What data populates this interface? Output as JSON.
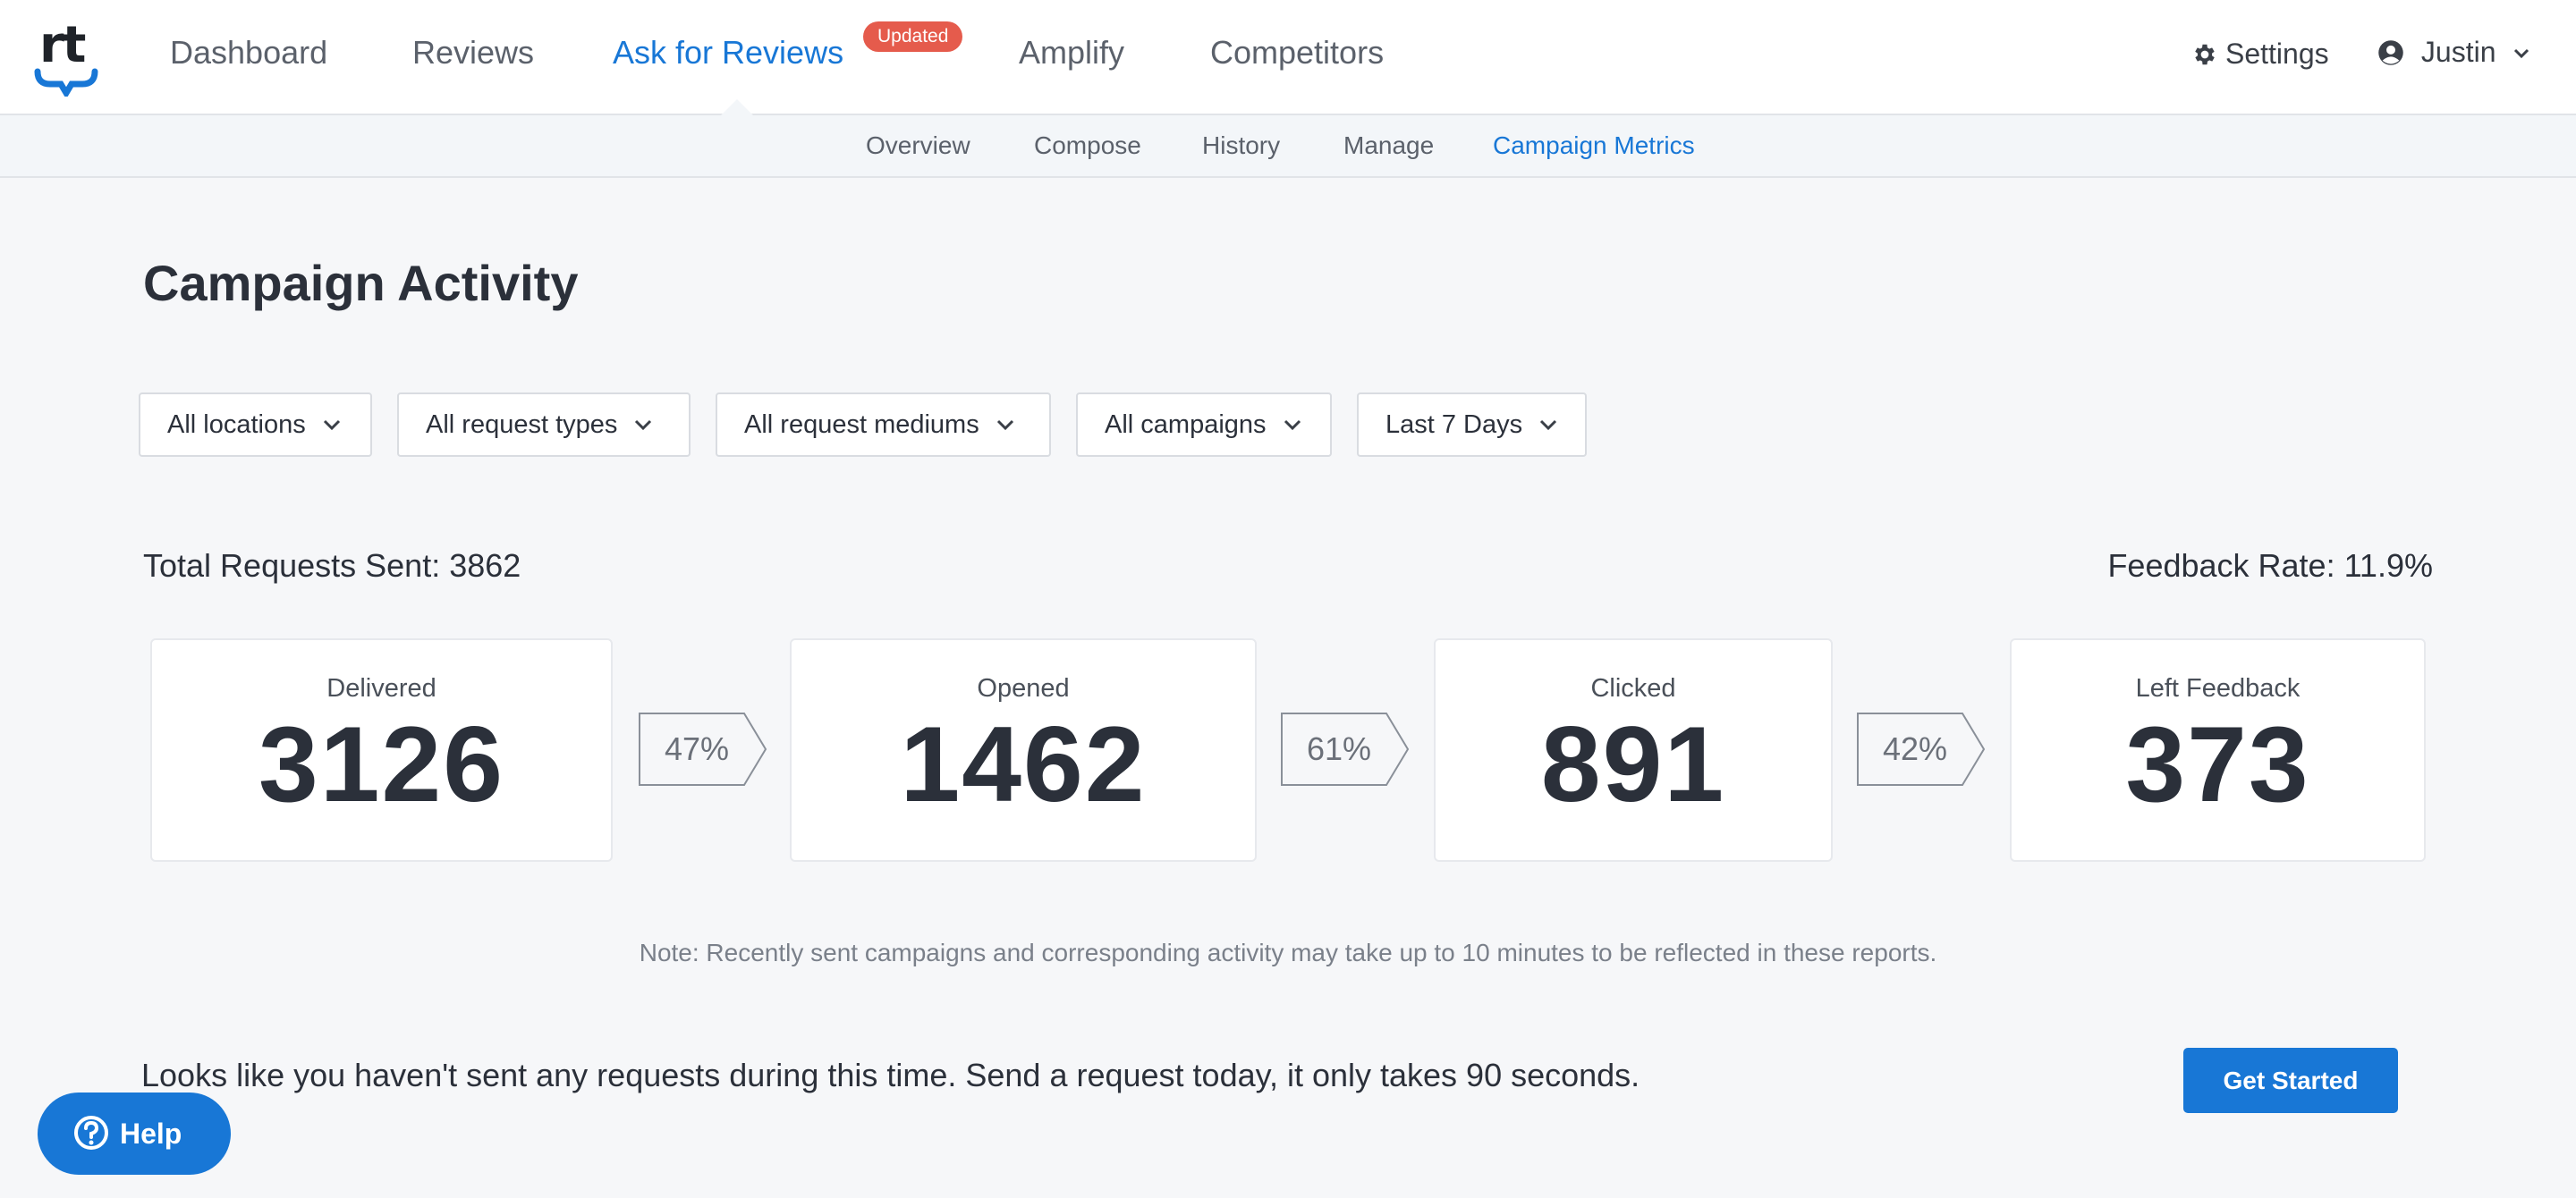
{
  "brand": {
    "logo_text": "rt",
    "accent": "#1877d6",
    "badge_color": "#e55b4c"
  },
  "nav": {
    "items": [
      {
        "label": "Dashboard",
        "active": false
      },
      {
        "label": "Reviews",
        "active": false
      },
      {
        "label": "Ask for Reviews",
        "active": true
      },
      {
        "label": "Amplify",
        "active": false
      },
      {
        "label": "Competitors",
        "active": false
      }
    ],
    "badge": "Updated",
    "settings_label": "Settings",
    "user_label": "Justin"
  },
  "subnav": {
    "items": [
      {
        "label": "Overview",
        "active": false
      },
      {
        "label": "Compose",
        "active": false
      },
      {
        "label": "History",
        "active": false
      },
      {
        "label": "Manage",
        "active": false
      },
      {
        "label": "Campaign Metrics",
        "active": true
      }
    ]
  },
  "page": {
    "title": "Campaign Activity"
  },
  "filters": [
    {
      "label": "All locations"
    },
    {
      "label": "All request types"
    },
    {
      "label": "All request mediums"
    },
    {
      "label": "All campaigns"
    },
    {
      "label": "Last 7 Days"
    }
  ],
  "summary": {
    "total_requests": "Total Requests Sent: 3862",
    "feedback_rate": "Feedback Rate: 11.9%"
  },
  "funnel": {
    "stages": [
      {
        "label": "Delivered",
        "value": "3126"
      },
      {
        "label": "Opened",
        "value": "1462"
      },
      {
        "label": "Clicked",
        "value": "891"
      },
      {
        "label": "Left Feedback",
        "value": "373"
      }
    ],
    "rates": [
      "47%",
      "61%",
      "42%"
    ]
  },
  "note": "Note: Recently sent campaigns and corresponding activity may take up to 10 minutes to be reflected in these reports.",
  "cta": {
    "text": "Looks like you haven't sent any requests during this time. Send a request today, it only takes 90 seconds.",
    "button": "Get Started"
  },
  "help": {
    "label": "Help"
  }
}
